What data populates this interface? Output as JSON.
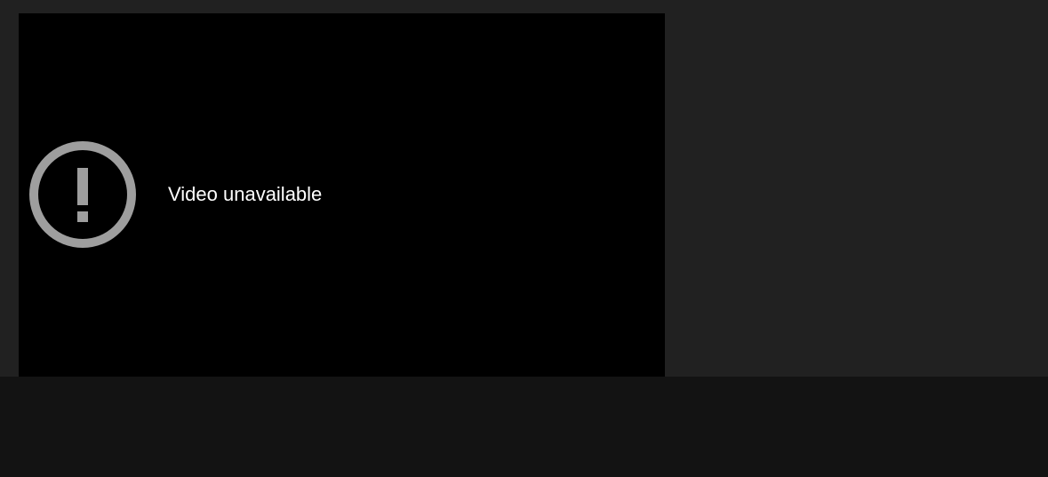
{
  "player": {
    "error_message": "Video unavailable",
    "error_icon": "exclamation-circle-icon"
  },
  "colors": {
    "page_background": "#212121",
    "player_background": "#000000",
    "icon_color": "#9e9e9e",
    "text_color": "#ffffff",
    "bottom_band": "#131313"
  }
}
